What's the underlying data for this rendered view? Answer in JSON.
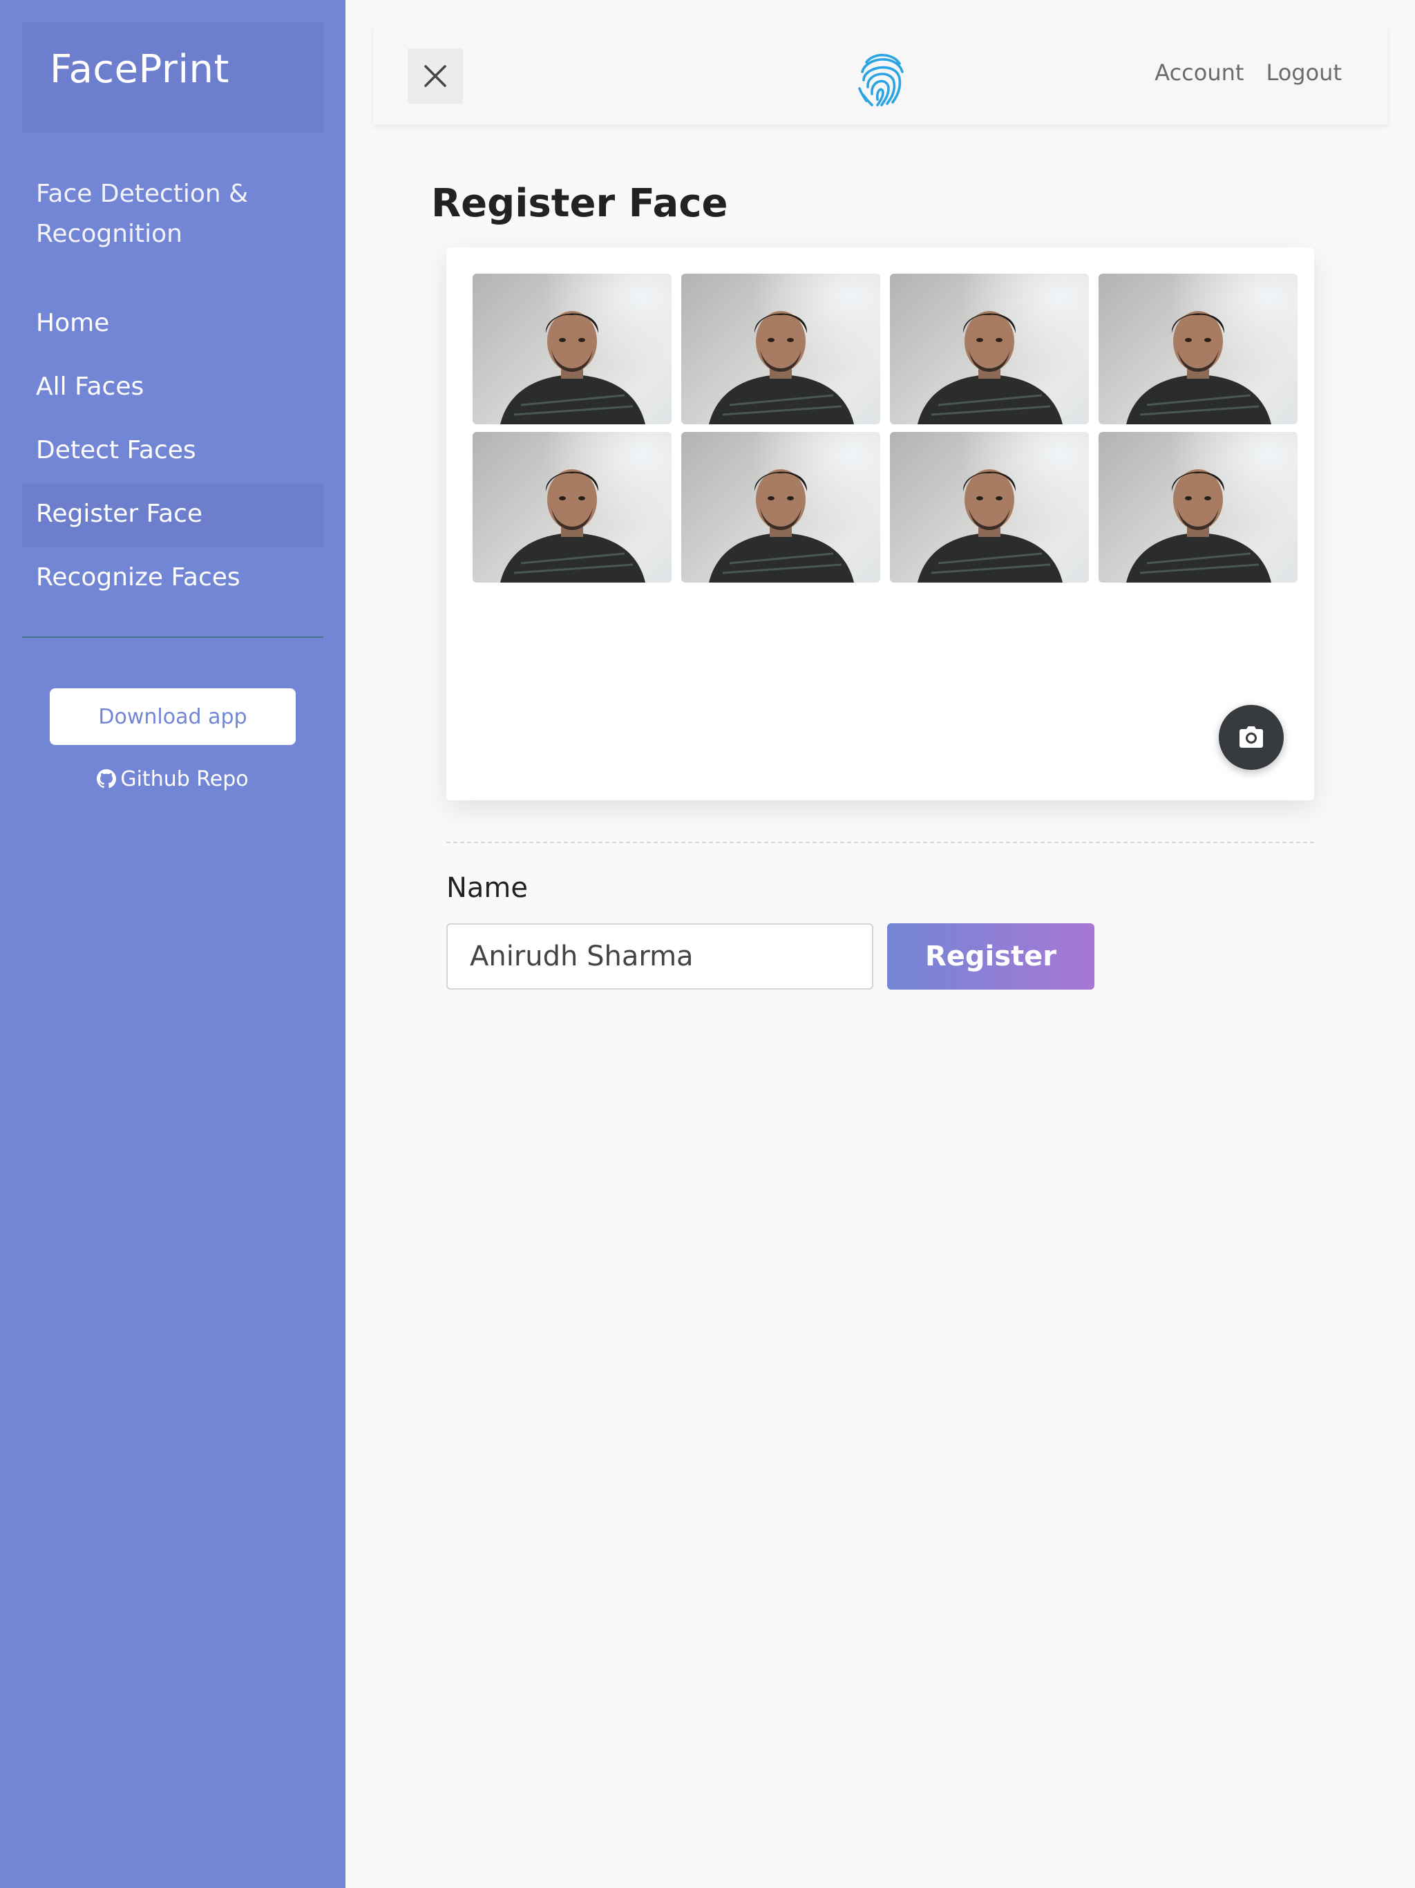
{
  "sidebar": {
    "brand": "FacePrint",
    "subtitle": "Face Detection & Recognition",
    "items": [
      {
        "label": "Home",
        "active": false
      },
      {
        "label": "All Faces",
        "active": false
      },
      {
        "label": "Detect Faces",
        "active": false
      },
      {
        "label": "Register Face",
        "active": true
      },
      {
        "label": "Recognize Faces",
        "active": false
      }
    ],
    "download_label": "Download app",
    "github_label": "Github Repo"
  },
  "topbar": {
    "close_icon": "close-icon",
    "logo_icon": "fingerprint-icon",
    "links": [
      "Account",
      "Logout"
    ]
  },
  "main": {
    "title": "Register Face",
    "captured_faces": [
      {
        "icon": "face-photo"
      },
      {
        "icon": "face-photo"
      },
      {
        "icon": "face-photo"
      },
      {
        "icon": "face-photo"
      },
      {
        "icon": "face-photo"
      },
      {
        "icon": "face-photo"
      },
      {
        "icon": "face-photo"
      },
      {
        "icon": "face-photo"
      }
    ],
    "camera_icon": "camera-icon",
    "name_label": "Name",
    "name_value": "Anirudh Sharma",
    "register_label": "Register"
  },
  "colors": {
    "sidebar_bg": "#7386d5",
    "sidebar_active": "#6d7fcc",
    "accent_gradient_start": "#7386d5",
    "accent_gradient_end": "#a877d5",
    "logo_blue": "#2aa4e3"
  }
}
